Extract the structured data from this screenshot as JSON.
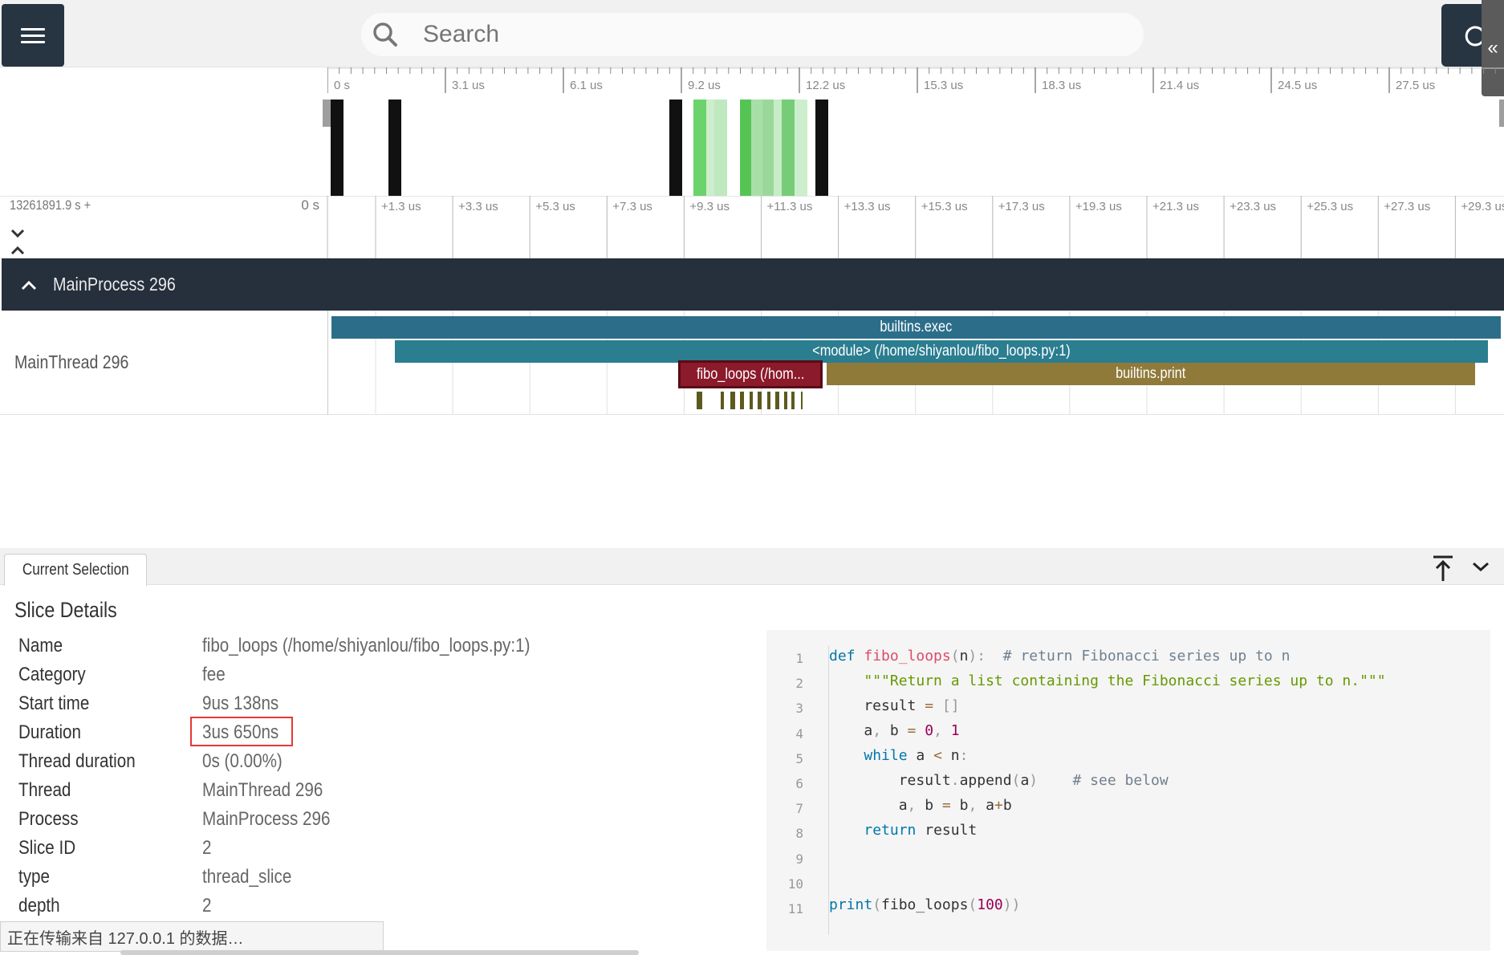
{
  "search": {
    "placeholder": "Search"
  },
  "right_btn": {
    "partial_icon": "C"
  },
  "collapse_btn": {
    "label": "«"
  },
  "overview_ticks": [
    "0 s",
    "3.1 us",
    "6.1 us",
    "9.2 us",
    "12.2 us",
    "15.3 us",
    "18.3 us",
    "21.4 us",
    "24.5 us",
    "27.5 us"
  ],
  "timeline": {
    "base_time": "13261891.9 s +",
    "zero_label": "0 s",
    "ticks": [
      "+1.3 us",
      "+3.3 us",
      "+5.3 us",
      "+7.3 us",
      "+9.3 us",
      "+11.3 us",
      "+13.3 us",
      "+15.3 us",
      "+17.3 us",
      "+19.3 us",
      "+21.3 us",
      "+23.3 us",
      "+25.3 us",
      "+27.3 us",
      "+29.3 us"
    ]
  },
  "process": {
    "title": "MainProcess 296"
  },
  "thread": {
    "title": "MainThread 296"
  },
  "slices": {
    "exec": "builtins.exec",
    "module": "<module> (/home/shiyanlou/fibo_loops.py:1)",
    "fibo": "fibo_loops (/hom...",
    "print": "builtins.print"
  },
  "colors": {
    "exec": "#2c6e8a",
    "module": "#2b7d90",
    "fibo": "#8b1a2b",
    "fibo_border": "#5a0a16",
    "print": "#8f7a3a",
    "header": "#262f3c",
    "sel": "#e53935"
  },
  "panel": {
    "tab": "Current Selection",
    "title": "Slice Details",
    "rows": [
      {
        "label": "Name",
        "value": "fibo_loops (/home/shiyanlou/fibo_loops.py:1)"
      },
      {
        "label": "Category",
        "value": "fee"
      },
      {
        "label": "Start time",
        "value": "9us 138ns"
      },
      {
        "label": "Duration",
        "value": "3us 650ns"
      },
      {
        "label": "Thread duration",
        "value": "0s (0.00%)"
      },
      {
        "label": "Thread",
        "value": "MainThread 296"
      },
      {
        "label": "Process",
        "value": "MainProcess 296"
      },
      {
        "label": "Slice ID",
        "value": "2"
      },
      {
        "label": "type",
        "value": "thread_slice"
      },
      {
        "label": "depth",
        "value": "2"
      }
    ]
  },
  "code": {
    "line_numbers": [
      "1",
      "2",
      "3",
      "4",
      "5",
      "6",
      "7",
      "8",
      "9",
      "10",
      "11"
    ]
  },
  "status": {
    "text": "正在传输来自 127.0.0.1 的数据…"
  }
}
